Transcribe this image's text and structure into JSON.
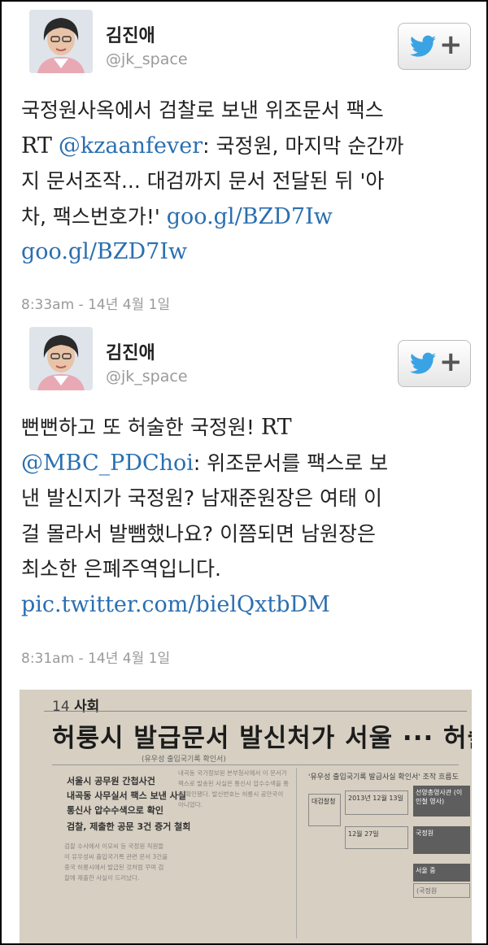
{
  "tweets": [
    {
      "author": "김진애",
      "handle": "@jk_space",
      "line1": "국정원사옥에서 검찰로 보낸 위조문서 팩스",
      "rt": "RT",
      "mention": "@kzaanfever",
      "line2_rest": ": 국정원, 마지막 순간까",
      "line3": "지 문서조작... 대검까지 문서 전달된 뒤 '아",
      "line4": "차, 팩스번호가!'",
      "link1": "goo.gl/BZD7Iw",
      "link2": "goo.gl/BZD7Iw",
      "timestamp": "8:33am - 14년 4월 1일"
    },
    {
      "author": "김진애",
      "handle": "@jk_space",
      "line1_text": "뻔뻔하고 또 허술한 국정원!",
      "rt": "RT",
      "mention": "@MBC_PDChoi",
      "line2_rest": ": 위조문서를 팩스로 보",
      "line3": "낸 발신지가 국정원? 남재준원장은 여태 이",
      "line4": "걸 몰라서 발뺌했나요? 이쯤되면 남원장은",
      "line5": "최소한 은폐주역입니다.",
      "link": "pic.twitter.com/bielQxtbDM",
      "timestamp": "8:31am - 14년 4월 1일"
    }
  ],
  "news_photo": {
    "page_number": "14",
    "section": "사회",
    "headline": "허룽시 발급문서 발신처가 서울 ··· 허술한",
    "subline": "(유우성 출입국기록 확인서)",
    "subheads": [
      "서울시 공무원 간첩사건",
      "내곡동 사무실서 팩스 보낸 사실",
      "통신사 압수수색으로 확인",
      "검찰, 제출한 공문 3건 증거 철회"
    ],
    "box_title": "'유우성 출입국기록 발급사실 확인서' 조작 흐름도",
    "box_labels": [
      "대검찰청",
      "선양총영사관 (이인철 영사)",
      "국정원",
      "서울 중",
      "(국정원"
    ],
    "box_date": "2013년 12월 13일",
    "box_date2": "12월 27일",
    "body_text": "검찰 수사에서 이모씨 등 국정원 직원들이 유우성씨 출입국기록 관련 문서 3건을 중국 허룽시에서 발급된 것처럼 꾸며 검찰에 제출한 사실이 드러났다.",
    "col2_text": "내곡동 국가정보원 본부청사에서 이 문서가 팩스로 발송된 사실은 통신사 압수수색을 통해 확인됐다. 발신번호는 허룽시 공안국이 아니었다."
  },
  "colors": {
    "link": "#2a6fb0",
    "text": "#222222",
    "meta": "#9a9a9a",
    "twitter_blue": "#3aa3e3"
  },
  "icons": [
    "twitter-bird-icon",
    "plus-icon"
  ]
}
